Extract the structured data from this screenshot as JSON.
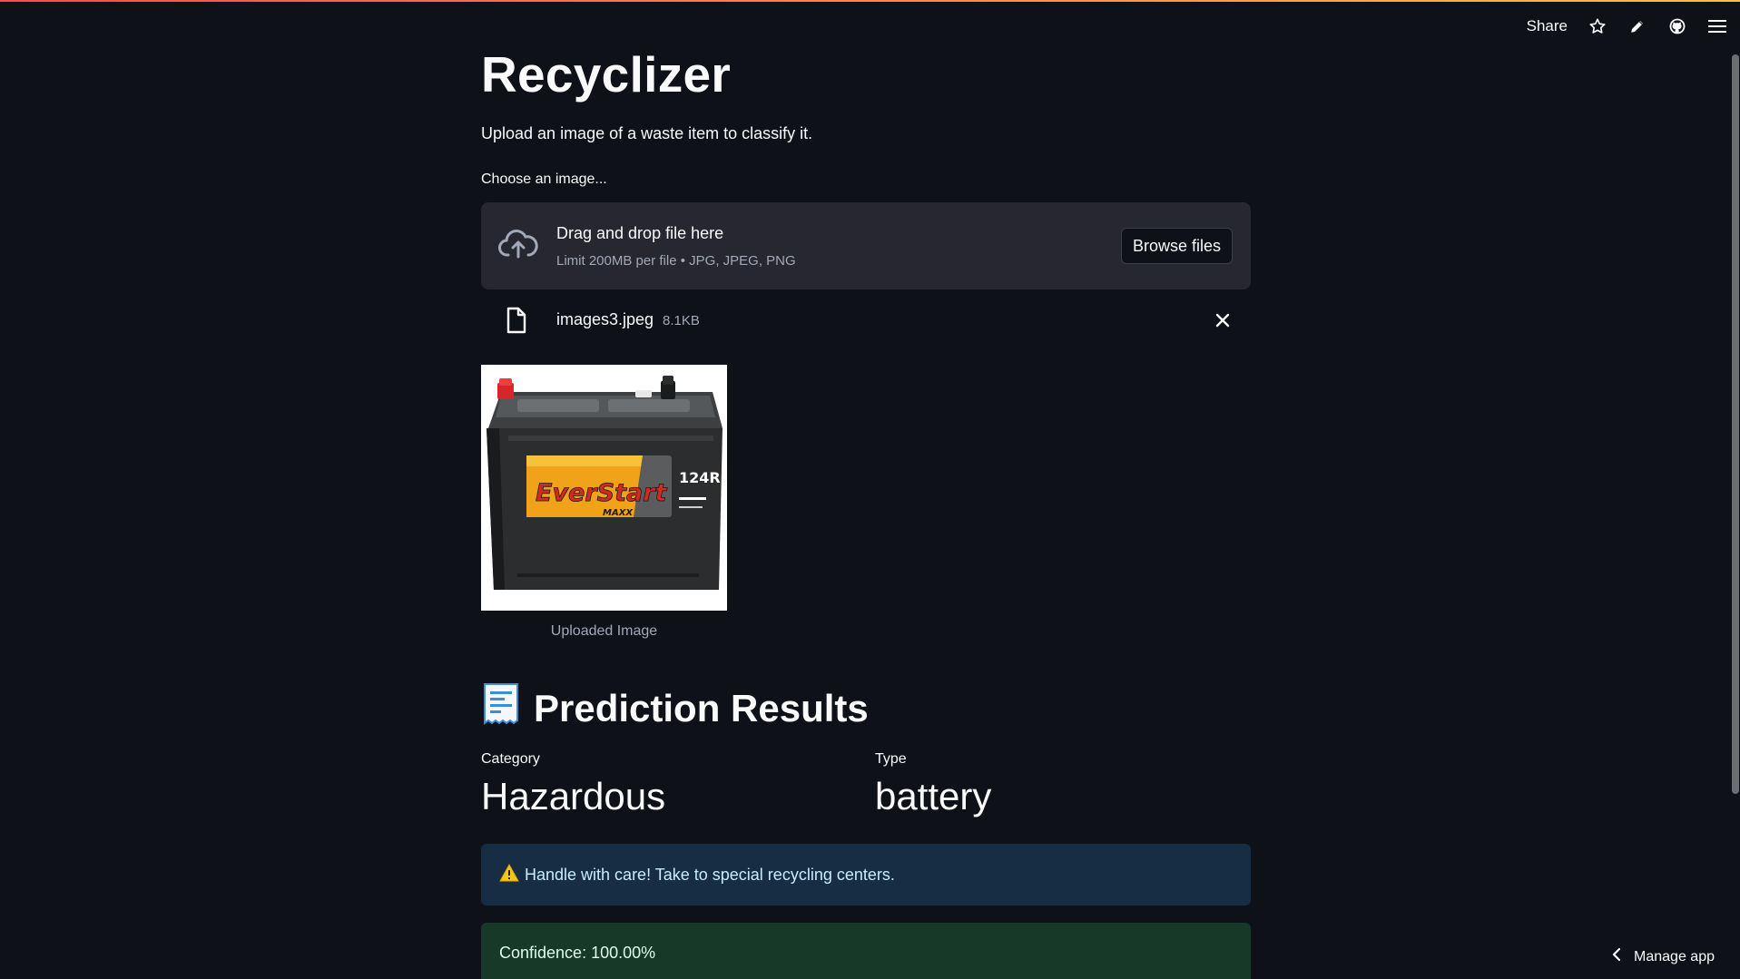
{
  "toolbar": {
    "share_label": "Share",
    "icons": [
      "star-icon",
      "pencil-icon",
      "github-icon",
      "hamburger-menu-icon"
    ]
  },
  "app": {
    "title": "Recyclizer",
    "subtitle": "Upload an image of a waste item to classify it."
  },
  "uploader": {
    "label": "Choose an image...",
    "drop_text": "Drag and drop file here",
    "limit_text": "Limit 200MB per file • JPG, JPEG, PNG",
    "browse_label": "Browse files",
    "file": {
      "name": "images3.jpeg",
      "size": "8.1KB"
    }
  },
  "image": {
    "caption": "Uploaded Image",
    "product_brand": "EverStart",
    "product_sub": "MAXX",
    "product_model": "124R"
  },
  "results": {
    "heading": "Prediction Results",
    "category_label": "Category",
    "category_value": "Hazardous",
    "type_label": "Type",
    "type_value": "battery",
    "warning": "Handle with care! Take to special recycling centers.",
    "confidence": "Confidence: 100.00%"
  },
  "footer": {
    "manage_label": "Manage app"
  },
  "colors": {
    "background": "#0e1117",
    "dropzone": "#262730",
    "info_bg": "#172d43",
    "success_bg": "#173928",
    "accent_gradient_start": "#ff4b4b",
    "accent_gradient_end": "#ffbd45"
  }
}
